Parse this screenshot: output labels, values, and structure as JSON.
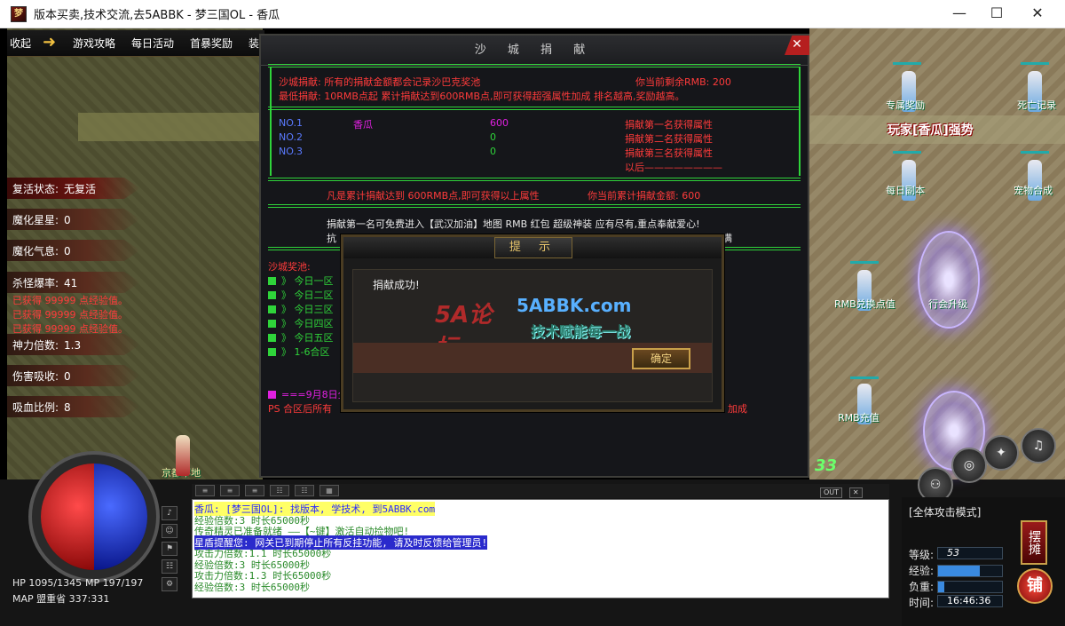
{
  "window": {
    "title": "版本买卖,技术交流,去5ABBK - 梦三国OL - 香瓜",
    "icon_label": "梦",
    "minimize": "—",
    "maximize": "☐",
    "close": "✕"
  },
  "topmenu": {
    "collapse": "收起",
    "items": [
      "游戏攻略",
      "每日活动",
      "首暴奖励",
      "装"
    ]
  },
  "left_stats": [
    {
      "label": "复活状态:",
      "value": "无复活"
    },
    {
      "label": "魔化星星:",
      "value": "0"
    },
    {
      "label": "魔化气息:",
      "value": "0"
    },
    {
      "label": "杀怪爆率:",
      "value": "41"
    },
    {
      "label": "神力倍数:",
      "value": "1.3"
    },
    {
      "label": "伤害吸收:",
      "value": "0"
    },
    {
      "label": "吸血比例:",
      "value": "8"
    }
  ],
  "kill_lines": [
    "已获得 99999 点经验值。",
    "已获得 99999 点经验值。",
    "已获得 99999 点经验值。"
  ],
  "map_npc_left": "京都苹地",
  "right_npcs": [
    {
      "name": "专属奖励"
    },
    {
      "name": "死亡记录"
    },
    {
      "name": "每日副本"
    },
    {
      "name": "宠物合成"
    },
    {
      "name": "RMB兑换点值"
    },
    {
      "name": "行会升级"
    },
    {
      "name": "RMB充值"
    }
  ],
  "banner": "玩家[香瓜]强势",
  "level_float": "33",
  "panel": {
    "title": "沙 城 捐 献",
    "close": "✕",
    "line1_left": "沙城捐献: 所有的捐献金额都会记录沙巴克奖池",
    "line1_right": "你当前剩余RMB: 200",
    "line2": "最低捐献: 10RMB点起 累计捐献达到600RMB点,即可获得超强属性加成 排名越高,奖励越高。",
    "ranks": [
      {
        "no": "NO.1",
        "name": "香瓜",
        "amount": "600",
        "reward": "捐献第一名获得属性"
      },
      {
        "no": "NO.2",
        "name": "",
        "amount": "0",
        "reward": "捐献第二名获得属性"
      },
      {
        "no": "NO.3",
        "name": "",
        "amount": "0",
        "reward": "捐献第三名获得属性"
      }
    ],
    "rank_after": "以后————————",
    "accum_left": "凡是累计捐献达到 600RMB点,即可获得以上属性",
    "accum_right": "你当前累计捐献金额: 600",
    "info1": "捐献第一名可免费进入【武汉加油】地图 RMB 红包 超级神装 应有尽有,重点奉献爱心!",
    "info2_left": "抗",
    "info2_right": "满",
    "pool_title": "沙城奖池:",
    "zones": [
      "》 今日一区",
      "》 今日二区",
      "》 今日三区",
      "》 今日四区",
      "》 今日五区",
      "》 1-6合区"
    ],
    "date_line": "===9月8日全",
    "ps_left": "PS 合区后所有",
    "ps_right": "加成"
  },
  "dialog": {
    "title": "提 示",
    "message": "捐献成功!",
    "ok": "确定",
    "watermark_logo": "5A论坛",
    "watermark_site": "5ABBK.com",
    "watermark_slogan": "技术赋能每一战"
  },
  "hud": {
    "hp": "HP  1095/1345",
    "mp": "MP  197/197",
    "map": "MAP  盟重省  337:331"
  },
  "chat_lines": [
    {
      "text": "香瓜: [梦三国OL]: 找版本, 学技术, 到5ABBK.com",
      "color": "#2a2aff",
      "bg": "#ffff66"
    },
    {
      "text": "经验倍数:3 时长65000秒",
      "color": "#2a8a2a",
      "bg": ""
    },
    {
      "text": "传奇精灵已准备就绪 ——【~键】激活自动捡物吧!",
      "color": "#2a8a2a",
      "bg": ""
    },
    {
      "text": "星盾提醒您: 网关已到期停止所有反挂功能, 请及时反馈给管理员!",
      "color": "#ffffff",
      "bg": "#2a2acc"
    },
    {
      "text": "攻击力倍数:1.1 时长65000秒",
      "color": "#2a8a2a",
      "bg": ""
    },
    {
      "text": "经验倍数:3 时长65000秒",
      "color": "#2a8a2a",
      "bg": ""
    },
    {
      "text": "攻击力倍数:1.3 时长65000秒",
      "color": "#2a8a2a",
      "bg": ""
    },
    {
      "text": "经验倍数:3 时长65000秒",
      "color": "#2a8a2a",
      "bg": ""
    }
  ],
  "right_hud": {
    "mode": "[全体攻击模式]",
    "level_label": "等级:",
    "level_value": "53",
    "exp_label": "经验:",
    "exp_fraction": 0.65,
    "load_label": "负重:",
    "load_fraction": 0.1,
    "time_label": "时间:",
    "time_value": "16:46:36",
    "stall_btn": "摆摊",
    "shop_btn": "铺"
  },
  "out_buttons": [
    "OUT",
    "✕"
  ]
}
